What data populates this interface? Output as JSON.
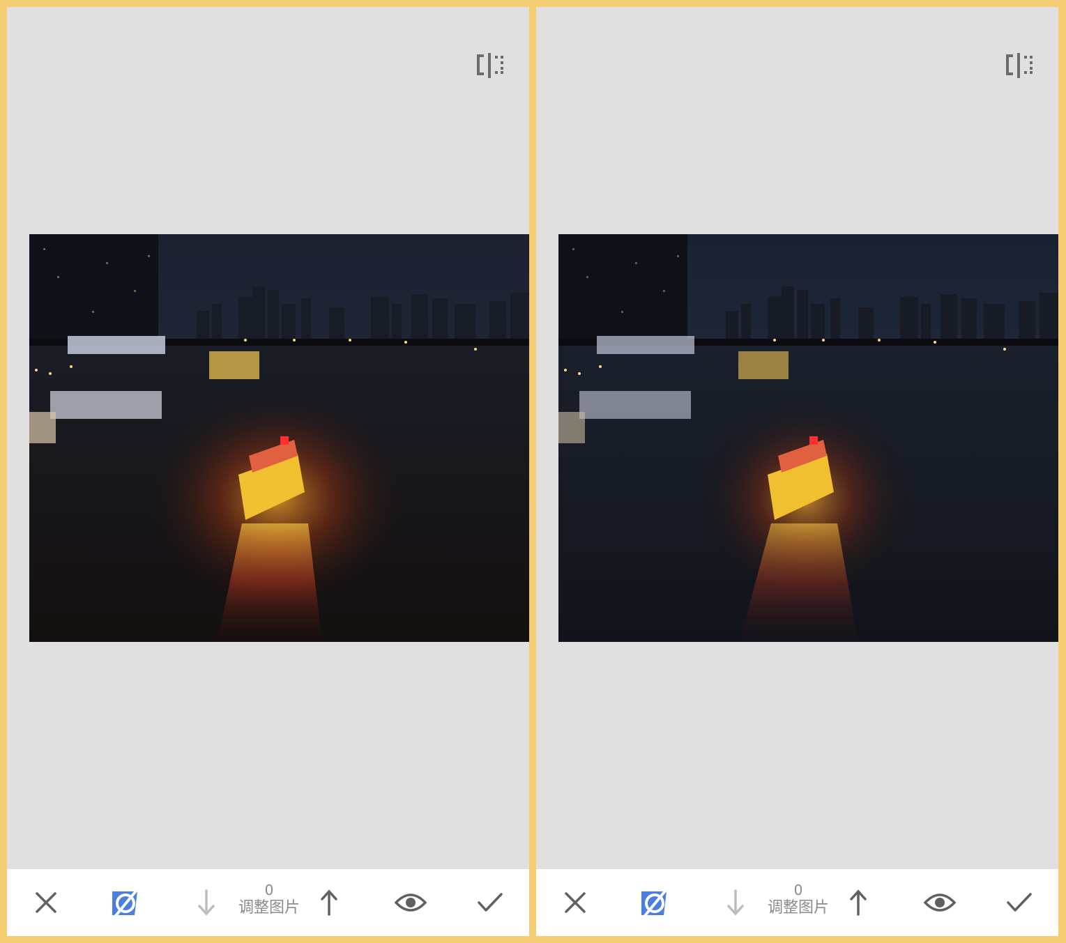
{
  "panels": [
    {
      "id": "left",
      "param": {
        "value": "0",
        "label": "调整图片"
      }
    },
    {
      "id": "right",
      "param": {
        "value": "0",
        "label": "调整图片"
      }
    }
  ],
  "icons": {
    "compare": "compare-icon",
    "close": "close-icon",
    "mask": "brush-mask-icon",
    "decrease": "arrow-down-icon",
    "increase": "arrow-up-icon",
    "view": "eye-icon",
    "confirm": "checkmark-icon"
  },
  "colors": {
    "frame": "#f5cd72",
    "canvas": "#e0e0e0",
    "toolbar": "#ffffff",
    "accent": "#4a7fe0",
    "icon_dark": "#5f5f5f",
    "icon_disabled": "#bdbdbd"
  }
}
